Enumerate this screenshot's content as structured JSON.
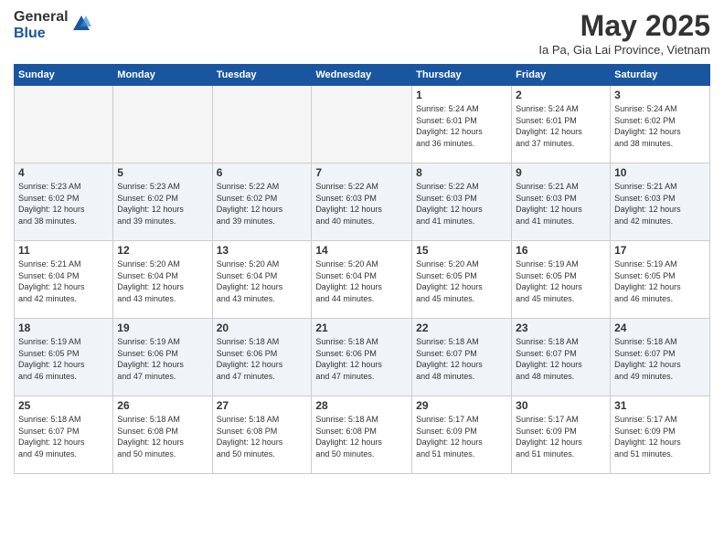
{
  "logo": {
    "general": "General",
    "blue": "Blue"
  },
  "title": "May 2025",
  "location": "Ia Pa, Gia Lai Province, Vietnam",
  "days_of_week": [
    "Sunday",
    "Monday",
    "Tuesday",
    "Wednesday",
    "Thursday",
    "Friday",
    "Saturday"
  ],
  "weeks": [
    [
      {
        "day": "",
        "info": ""
      },
      {
        "day": "",
        "info": ""
      },
      {
        "day": "",
        "info": ""
      },
      {
        "day": "",
        "info": ""
      },
      {
        "day": "1",
        "info": "Sunrise: 5:24 AM\nSunset: 6:01 PM\nDaylight: 12 hours\nand 36 minutes."
      },
      {
        "day": "2",
        "info": "Sunrise: 5:24 AM\nSunset: 6:01 PM\nDaylight: 12 hours\nand 37 minutes."
      },
      {
        "day": "3",
        "info": "Sunrise: 5:24 AM\nSunset: 6:02 PM\nDaylight: 12 hours\nand 38 minutes."
      }
    ],
    [
      {
        "day": "4",
        "info": "Sunrise: 5:23 AM\nSunset: 6:02 PM\nDaylight: 12 hours\nand 38 minutes."
      },
      {
        "day": "5",
        "info": "Sunrise: 5:23 AM\nSunset: 6:02 PM\nDaylight: 12 hours\nand 39 minutes."
      },
      {
        "day": "6",
        "info": "Sunrise: 5:22 AM\nSunset: 6:02 PM\nDaylight: 12 hours\nand 39 minutes."
      },
      {
        "day": "7",
        "info": "Sunrise: 5:22 AM\nSunset: 6:03 PM\nDaylight: 12 hours\nand 40 minutes."
      },
      {
        "day": "8",
        "info": "Sunrise: 5:22 AM\nSunset: 6:03 PM\nDaylight: 12 hours\nand 41 minutes."
      },
      {
        "day": "9",
        "info": "Sunrise: 5:21 AM\nSunset: 6:03 PM\nDaylight: 12 hours\nand 41 minutes."
      },
      {
        "day": "10",
        "info": "Sunrise: 5:21 AM\nSunset: 6:03 PM\nDaylight: 12 hours\nand 42 minutes."
      }
    ],
    [
      {
        "day": "11",
        "info": "Sunrise: 5:21 AM\nSunset: 6:04 PM\nDaylight: 12 hours\nand 42 minutes."
      },
      {
        "day": "12",
        "info": "Sunrise: 5:20 AM\nSunset: 6:04 PM\nDaylight: 12 hours\nand 43 minutes."
      },
      {
        "day": "13",
        "info": "Sunrise: 5:20 AM\nSunset: 6:04 PM\nDaylight: 12 hours\nand 43 minutes."
      },
      {
        "day": "14",
        "info": "Sunrise: 5:20 AM\nSunset: 6:04 PM\nDaylight: 12 hours\nand 44 minutes."
      },
      {
        "day": "15",
        "info": "Sunrise: 5:20 AM\nSunset: 6:05 PM\nDaylight: 12 hours\nand 45 minutes."
      },
      {
        "day": "16",
        "info": "Sunrise: 5:19 AM\nSunset: 6:05 PM\nDaylight: 12 hours\nand 45 minutes."
      },
      {
        "day": "17",
        "info": "Sunrise: 5:19 AM\nSunset: 6:05 PM\nDaylight: 12 hours\nand 46 minutes."
      }
    ],
    [
      {
        "day": "18",
        "info": "Sunrise: 5:19 AM\nSunset: 6:05 PM\nDaylight: 12 hours\nand 46 minutes."
      },
      {
        "day": "19",
        "info": "Sunrise: 5:19 AM\nSunset: 6:06 PM\nDaylight: 12 hours\nand 47 minutes."
      },
      {
        "day": "20",
        "info": "Sunrise: 5:18 AM\nSunset: 6:06 PM\nDaylight: 12 hours\nand 47 minutes."
      },
      {
        "day": "21",
        "info": "Sunrise: 5:18 AM\nSunset: 6:06 PM\nDaylight: 12 hours\nand 47 minutes."
      },
      {
        "day": "22",
        "info": "Sunrise: 5:18 AM\nSunset: 6:07 PM\nDaylight: 12 hours\nand 48 minutes."
      },
      {
        "day": "23",
        "info": "Sunrise: 5:18 AM\nSunset: 6:07 PM\nDaylight: 12 hours\nand 48 minutes."
      },
      {
        "day": "24",
        "info": "Sunrise: 5:18 AM\nSunset: 6:07 PM\nDaylight: 12 hours\nand 49 minutes."
      }
    ],
    [
      {
        "day": "25",
        "info": "Sunrise: 5:18 AM\nSunset: 6:07 PM\nDaylight: 12 hours\nand 49 minutes."
      },
      {
        "day": "26",
        "info": "Sunrise: 5:18 AM\nSunset: 6:08 PM\nDaylight: 12 hours\nand 50 minutes."
      },
      {
        "day": "27",
        "info": "Sunrise: 5:18 AM\nSunset: 6:08 PM\nDaylight: 12 hours\nand 50 minutes."
      },
      {
        "day": "28",
        "info": "Sunrise: 5:18 AM\nSunset: 6:08 PM\nDaylight: 12 hours\nand 50 minutes."
      },
      {
        "day": "29",
        "info": "Sunrise: 5:17 AM\nSunset: 6:09 PM\nDaylight: 12 hours\nand 51 minutes."
      },
      {
        "day": "30",
        "info": "Sunrise: 5:17 AM\nSunset: 6:09 PM\nDaylight: 12 hours\nand 51 minutes."
      },
      {
        "day": "31",
        "info": "Sunrise: 5:17 AM\nSunset: 6:09 PM\nDaylight: 12 hours\nand 51 minutes."
      }
    ]
  ]
}
